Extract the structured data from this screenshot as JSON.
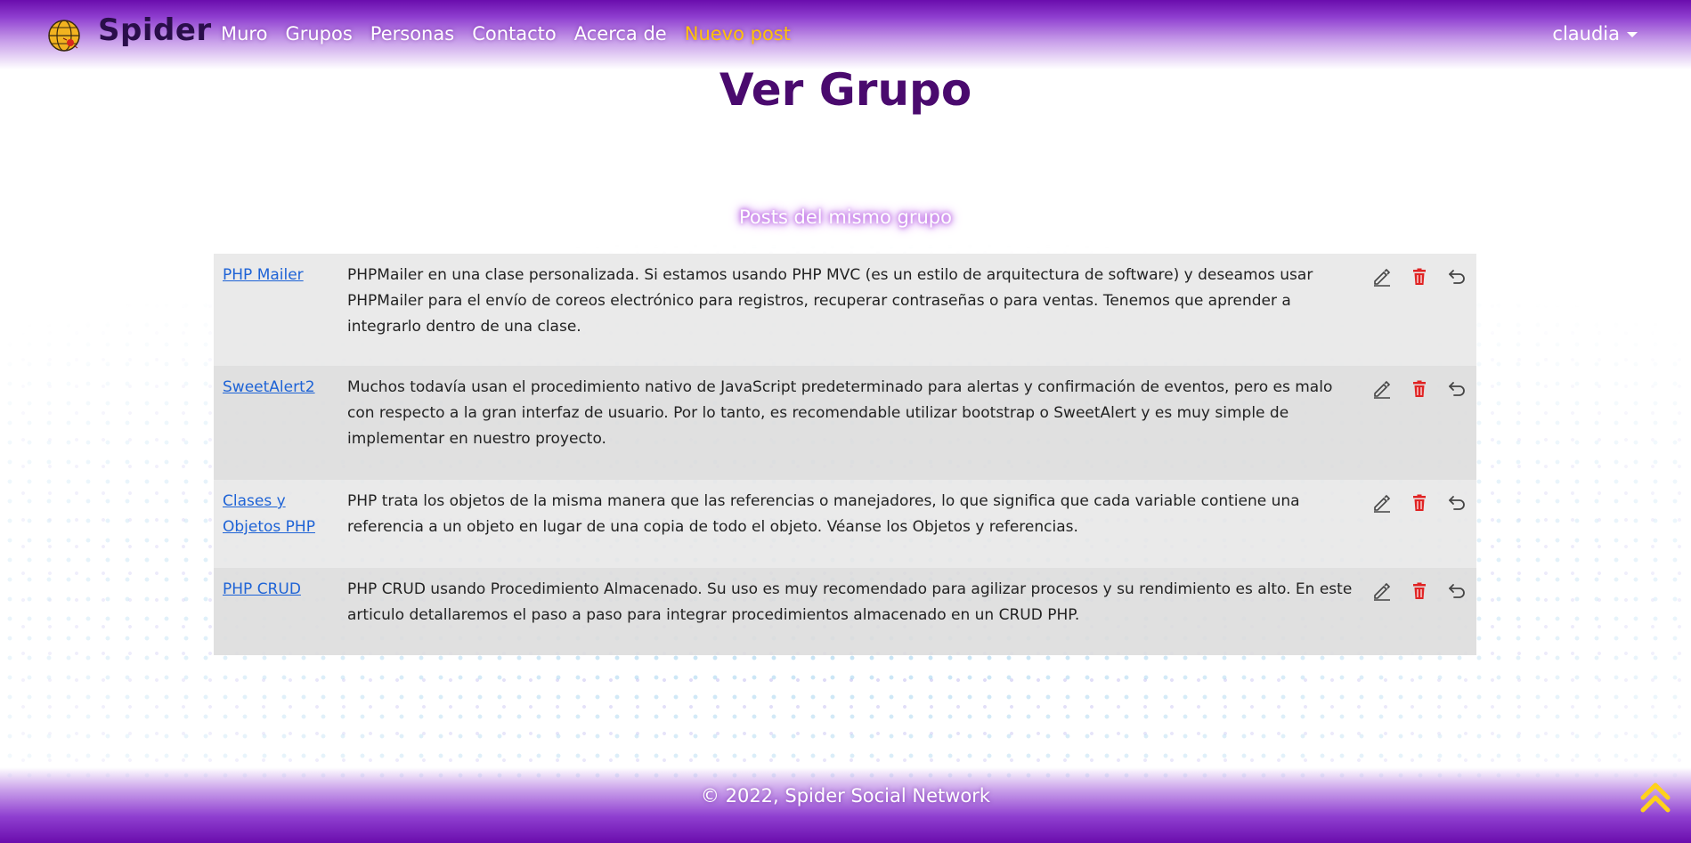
{
  "navbar": {
    "brand": "Spider",
    "links": [
      "Muro",
      "Grupos",
      "Personas",
      "Contacto",
      "Acerca de",
      "Nuevo post"
    ],
    "user": "claudia"
  },
  "page": {
    "title": "Ver Grupo",
    "section_title": "Posts del mismo grupo"
  },
  "posts": [
    {
      "title": "PHP Mailer",
      "description": "PHPMailer en una clase personalizada. Si estamos usando PHP MVC (es un estilo de arquitectura de software) y deseamos usar PHPMailer para el envío de coreos electrónico para registros, recuperar contraseñas o para ventas. Tenemos que aprender a integrarlo dentro de una clase."
    },
    {
      "title": "SweetAlert2",
      "description": "Muchos todavía usan el procedimiento nativo de JavaScript predeterminado para alertas y confirmación de eventos, pero es malo con respecto a la gran interfaz de usuario. Por lo tanto, es recomendable utilizar bootstrap o SweetAlert y es muy simple de implementar en nuestro proyecto."
    },
    {
      "title": "Clases y Objetos PHP",
      "description": "PHP trata los objetos de la misma manera que las referencias o manejadores, lo que significa que cada variable contiene una referencia a un objeto en lugar de una copia de todo el objeto. Véanse los Objetos y referencias."
    },
    {
      "title": "PHP CRUD",
      "description": "PHP CRUD usando Procedimiento Almacenado. Su uso es muy recomendado para agilizar procesos y su rendimiento es alto. En este articulo detallaremos el paso a paso para integrar procedimientos almacenado en un CRUD PHP."
    }
  ],
  "icons": {
    "edit": "pencil-icon",
    "delete": "trash-icon",
    "back": "undo-arrow-icon"
  },
  "colors": {
    "brand_purple": "#6a0dad",
    "title_purple": "#4a0a6e",
    "accent_yellow": "#ffc107",
    "delete_red": "#e02424",
    "link_blue": "#1e63d6"
  },
  "footer": {
    "copyright": "© 2022, Spider Social Network"
  }
}
